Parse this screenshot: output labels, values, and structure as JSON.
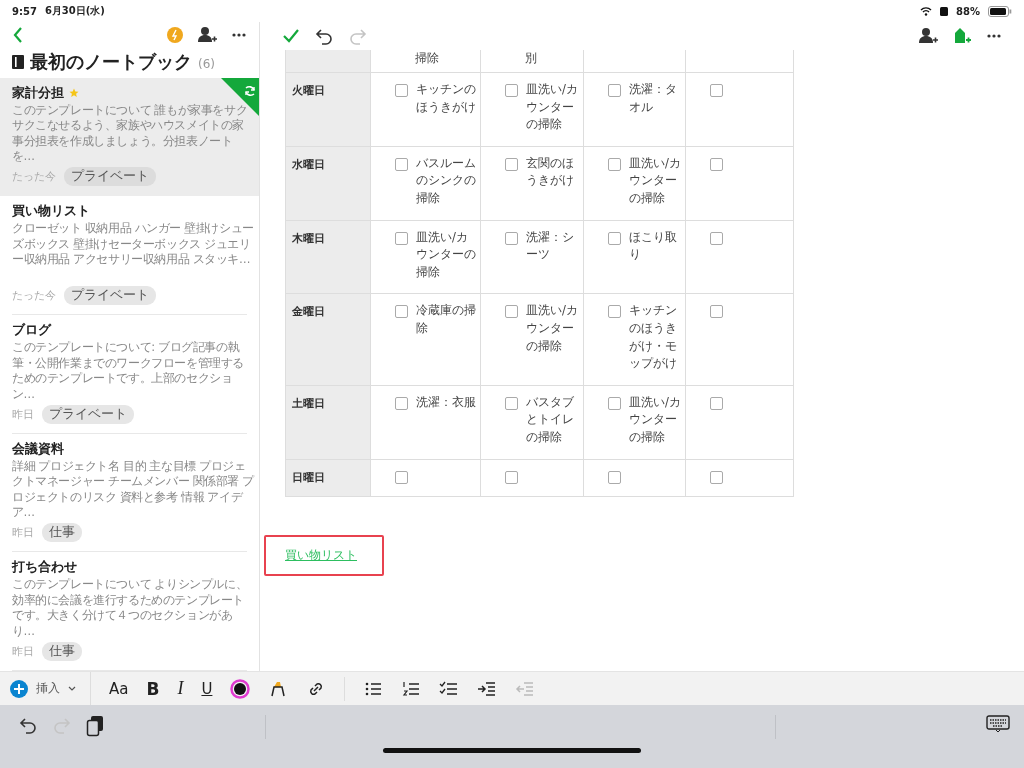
{
  "status_bar": {
    "time": "9:57",
    "date": "6月30日(水)",
    "battery": "88%"
  },
  "note_list": {
    "notebook_title": "最初のノートブック",
    "count": "(6)",
    "notes": [
      {
        "title": "家計分担",
        "favorite": true,
        "snippet": "このテンプレートについて 誰もが家事をサクサクこなせるよう、家族やハウスメイトの家事分担表を作成しましょう。分担表ノートを…",
        "date": "たった今",
        "tag": "プライベート",
        "selected": true,
        "synced": true
      },
      {
        "title": "買い物リスト",
        "favorite": false,
        "snippet": "クローゼット 収納用品 ハンガー 壁掛けシューズボックス 壁掛けセーターボックス ジュエリー収納用品 アクセサリー収納用品 スタッキ…",
        "date": "たった今",
        "tag": "プライベート",
        "selected": false,
        "synced": false
      },
      {
        "title": "ブログ",
        "favorite": false,
        "snippet": "このテンプレートについて: ブログ記事の執筆・公開作業までのワークフローを管理するためのテンプレートです。上部のセクション…",
        "date": "昨日",
        "tag": "プライベート",
        "selected": false,
        "synced": false
      },
      {
        "title": "会議資料",
        "favorite": false,
        "snippet": "詳細 プロジェクト名 目的 主な目標 プロジェクトマネージャー チームメンバー 関係部署 プロジェクトのリスク 資料と参考 情報 アイデア…",
        "date": "昨日",
        "tag": "仕事",
        "selected": false,
        "synced": false
      },
      {
        "title": "打ち合わせ",
        "favorite": false,
        "snippet": "このテンプレートについて よりシンプルに、効率的に会議を進行するためのテンプレートです。大きく分けて４つのセクションがあり…",
        "date": "昨日",
        "tag": "仕事",
        "selected": false,
        "synced": false
      }
    ]
  },
  "editor": {
    "history": [
      {
        "kind": "undo",
        "disabled": false
      },
      {
        "kind": "redo",
        "disabled": true
      }
    ],
    "table": {
      "rows": [
        {
          "day": "",
          "cells": [
            {
              "kind": "text",
              "text": "掃除"
            },
            {
              "kind": "text",
              "text": "別"
            },
            {
              "kind": "text",
              "text": ""
            },
            {
              "kind": "text",
              "text": ""
            }
          ]
        },
        {
          "day": "火曜日",
          "cells": [
            {
              "kind": "task",
              "text": "キッチンのほうきがけ",
              "checked": false
            },
            {
              "kind": "task",
              "text": "皿洗い/カウンターの掃除",
              "checked": false
            },
            {
              "kind": "task",
              "text": "洗濯：タオル",
              "checked": false
            },
            {
              "kind": "task",
              "text": "",
              "checked": false
            }
          ]
        },
        {
          "day": "水曜日",
          "cells": [
            {
              "kind": "task",
              "text": "バスルームのシンクの掃除",
              "checked": false
            },
            {
              "kind": "task",
              "text": "玄関のほうきがけ",
              "checked": false
            },
            {
              "kind": "task",
              "text": "皿洗い/カウンターの掃除",
              "checked": false
            },
            {
              "kind": "task",
              "text": "",
              "checked": false
            }
          ]
        },
        {
          "day": "木曜日",
          "cells": [
            {
              "kind": "task",
              "text": "皿洗い/カウンターの掃除",
              "checked": false
            },
            {
              "kind": "task",
              "text": "洗濯：シーツ",
              "checked": false
            },
            {
              "kind": "task",
              "text": "ほこり取り",
              "checked": false
            },
            {
              "kind": "task",
              "text": "",
              "checked": false
            }
          ]
        },
        {
          "day": "金曜日",
          "cells": [
            {
              "kind": "task",
              "text": "冷蔵庫の掃除",
              "checked": false
            },
            {
              "kind": "task",
              "text": "皿洗い/カウンターの掃除",
              "checked": false
            },
            {
              "kind": "task",
              "text": "キッチンのほうきがけ・モップがけ",
              "checked": false
            },
            {
              "kind": "task",
              "text": "",
              "checked": false
            }
          ]
        },
        {
          "day": "土曜日",
          "cells": [
            {
              "kind": "task",
              "text": "洗濯：衣服",
              "checked": false
            },
            {
              "kind": "task",
              "text": "バスタブとトイレの掃除",
              "checked": false
            },
            {
              "kind": "task",
              "text": "皿洗い/カウンターの掃除",
              "checked": false
            },
            {
              "kind": "task",
              "text": "",
              "checked": false
            }
          ]
        },
        {
          "day": "日曜日",
          "cells": [
            {
              "kind": "task",
              "text": "",
              "checked": false
            },
            {
              "kind": "task",
              "text": "",
              "checked": false
            },
            {
              "kind": "task",
              "text": "",
              "checked": false
            },
            {
              "kind": "task",
              "text": "",
              "checked": false
            }
          ]
        }
      ]
    },
    "link": "買い物リスト"
  },
  "format_toolbar": {
    "insert": "挿入",
    "items": [
      {
        "kind": "font",
        "label": "Aa",
        "disabled": false
      },
      {
        "kind": "bold",
        "label": "B",
        "disabled": false
      },
      {
        "kind": "italic",
        "label": "I",
        "disabled": false
      },
      {
        "kind": "underline",
        "label": "U",
        "disabled": false
      },
      {
        "kind": "color",
        "disabled": false
      },
      {
        "kind": "highlight",
        "disabled": false
      },
      {
        "kind": "link",
        "disabled": false
      },
      {
        "kind": "bullets",
        "disabled": false
      },
      {
        "kind": "numbered",
        "disabled": false
      },
      {
        "kind": "checklist",
        "disabled": false
      },
      {
        "kind": "indent",
        "disabled": false
      },
      {
        "kind": "outdent",
        "disabled": true
      }
    ]
  },
  "bottom_bar": {
    "history": [
      {
        "kind": "undo",
        "disabled": false
      },
      {
        "kind": "redo",
        "disabled": true
      }
    ]
  }
}
